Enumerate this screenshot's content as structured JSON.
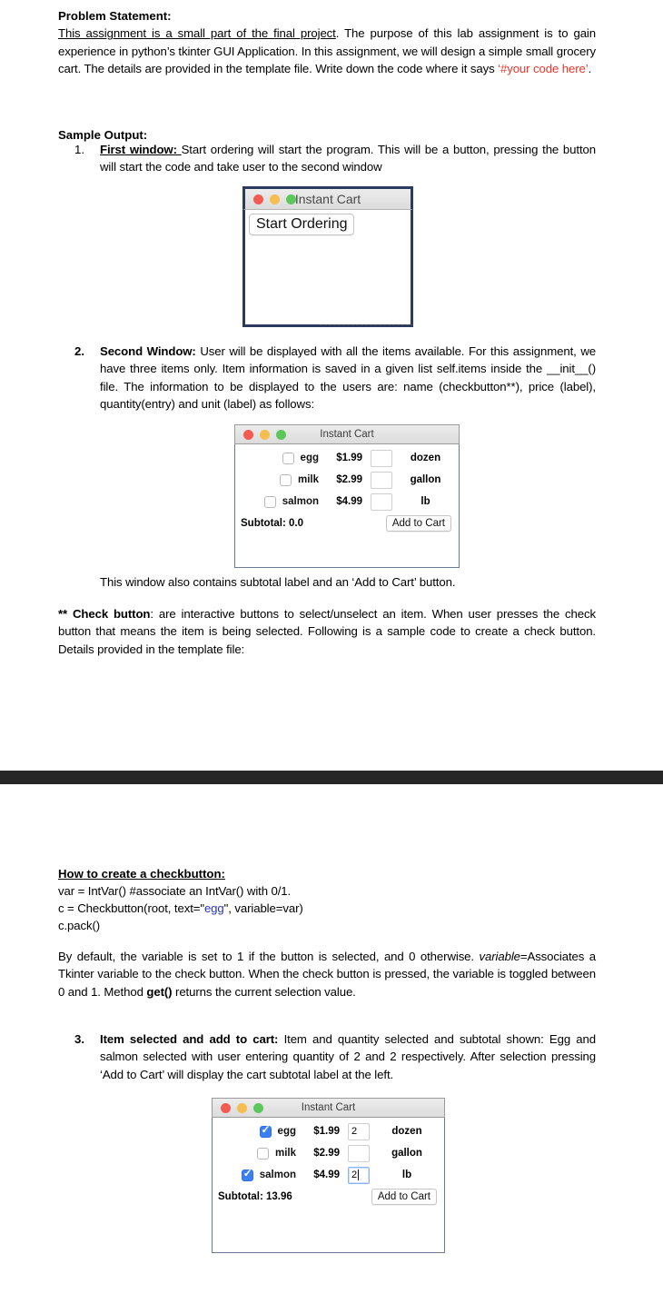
{
  "document": {
    "problem_heading": "Problem Statement:",
    "problem_underlined": "This assignment is a small part of the final project",
    "problem_body_1": ". The purpose of this lab assignment is to gain experience in python’s tkinter GUI Application. In this assignment, we will design a simple small grocery cart. The details are provided in the template file. Write down the code where it says ",
    "problem_code_ref": "‘#your code here’",
    "problem_body_2": ".",
    "sample_output_heading": "Sample Output:",
    "items": [
      {
        "number": "1.",
        "bold_lead": "First window: ",
        "text": "Start ordering will start the program. This will be a button, pressing the button will start the code and take user to the second window"
      },
      {
        "number": "2.",
        "bold_lead": "Second Window: ",
        "text": "User will be displayed with all the items available. For this assignment, we have three items only. Item information is saved in a given list self.items inside the __init__() file. The information to be displayed to the users are: name (checkbutton**), price (label), quantity(entry) and unit (label) as follows:"
      },
      {
        "number": "3.",
        "bold_lead": "Item selected and add to cart: ",
        "text": "Item and quantity selected and subtotal shown: Egg and salmon selected with user entering quantity of 2 and 2 respectively. After selection pressing ‘Add to Cart’ will display the cart subtotal label at the left."
      }
    ],
    "caption_window2": "This window also contains subtotal label and an ‘Add to Cart’ button.",
    "checkbutton_note": {
      "bold_lead": "** Check button",
      "text": ": are interactive buttons to select/unselect an item. When user presses the check button that means the item is being selected. Following is a sample code to create a check button. Details provided in the template file:"
    },
    "howto_heading": "How to create a checkbutton:",
    "code_lines": {
      "line1": "var = IntVar() #associate an IntVar() with 0/1.",
      "line2_pre": "c = Checkbutton(root, text=\"",
      "line2_str": "egg",
      "line2_post": "\", variable=var)",
      "line3": "c.pack()"
    },
    "default_note": {
      "part1": "By default, the variable is set to 1 if the button is selected, and 0 otherwise. ",
      "italic": "variable",
      "part2": "=Associates a Tkinter variable to the check button. When the check button is pressed, the variable is toggled between 0 and 1. Method ",
      "bold": "get()",
      "part3": " returns the current selection value."
    }
  },
  "colors": {
    "red_text": "#e8362a",
    "blue_string": "#2b37a8",
    "band": "#262626",
    "window_border_navy": "#2b3b60",
    "checkbox_checked": "#3b7ff5",
    "light_red": "#f25b54",
    "light_yellow": "#f6bd4f",
    "light_green": "#5cc75a"
  },
  "window1": {
    "title": "Instant Cart",
    "start_button": "Start Ordering",
    "lights": [
      "close",
      "minimize",
      "zoom"
    ]
  },
  "window2": {
    "title": "Instant Cart",
    "rows": [
      {
        "checked": false,
        "name": "egg",
        "price": "$1.99",
        "qty": "",
        "unit": "dozen",
        "focused": false
      },
      {
        "checked": false,
        "name": "milk",
        "price": "$2.99",
        "qty": "",
        "unit": "gallon",
        "focused": false
      },
      {
        "checked": false,
        "name": "salmon",
        "price": "$4.99",
        "qty": "",
        "unit": "lb",
        "focused": false
      }
    ],
    "subtotal": "Subtotal: 0.0",
    "add_to_cart": "Add to Cart"
  },
  "window3": {
    "title": "Instant Cart",
    "rows": [
      {
        "checked": true,
        "name": "egg",
        "price": "$1.99",
        "qty": "2",
        "unit": "dozen",
        "focused": false
      },
      {
        "checked": false,
        "name": "milk",
        "price": "$2.99",
        "qty": "",
        "unit": "gallon",
        "focused": false
      },
      {
        "checked": true,
        "name": "salmon",
        "price": "$4.99",
        "qty": "2",
        "unit": "lb",
        "focused": true
      }
    ],
    "subtotal": "Subtotal: 13.96",
    "add_to_cart": "Add to Cart"
  }
}
